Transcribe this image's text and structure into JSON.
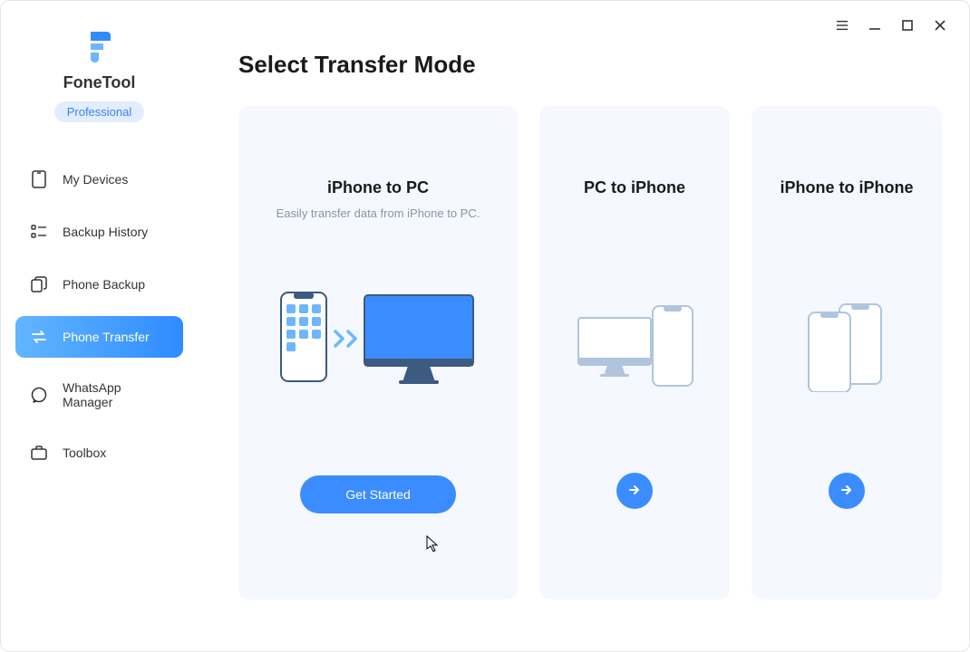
{
  "brand": {
    "name": "FoneTool",
    "badge": "Professional"
  },
  "nav": {
    "items": [
      {
        "label": "My Devices"
      },
      {
        "label": "Backup History"
      },
      {
        "label": "Phone Backup"
      },
      {
        "label": "Phone Transfer"
      },
      {
        "label": "WhatsApp Manager"
      },
      {
        "label": "Toolbox"
      }
    ]
  },
  "page": {
    "title": "Select Transfer Mode"
  },
  "cards": {
    "iphone_to_pc": {
      "title": "iPhone to PC",
      "desc": "Easily transfer data from iPhone to PC.",
      "cta": "Get Started"
    },
    "pc_to_iphone": {
      "title": "PC to iPhone"
    },
    "iphone_to_iphone": {
      "title": "iPhone to iPhone"
    }
  }
}
